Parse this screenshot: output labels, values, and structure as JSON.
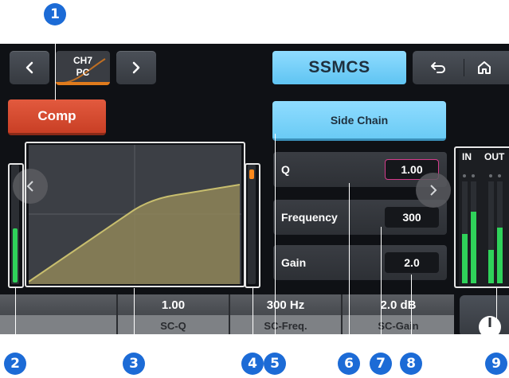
{
  "header": {
    "channel_name": "CH7",
    "channel_sub": "PC",
    "title": "SSMCS"
  },
  "comp_button": "Comp",
  "side_chain_button": "Side Chain",
  "params": [
    {
      "label": "Q",
      "value": "1.00",
      "selected": true
    },
    {
      "label": "Frequency",
      "value": "300",
      "selected": false
    },
    {
      "label": "Gain",
      "value": "2.0",
      "selected": false
    }
  ],
  "io_meter": {
    "in_label": "IN",
    "out_label": "OUT"
  },
  "bottom_strip": [
    {
      "value": "",
      "label": ""
    },
    {
      "value": "1.00",
      "label": "SC-Q"
    },
    {
      "value": "300 Hz",
      "label": "SC-Freq."
    },
    {
      "value": "2.0 dB",
      "label": "SC-Gain"
    }
  ],
  "callouts": [
    "1",
    "2",
    "3",
    "4",
    "5",
    "6",
    "7",
    "8",
    "9"
  ],
  "icons": {
    "prev": "chevron-left-icon",
    "next": "chevron-right-icon",
    "back": "return-arrow-icon",
    "home": "home-icon",
    "knob": "knob-icon"
  },
  "colors": {
    "accent_blue": "#6acbf5",
    "comp_red": "#d9482d",
    "meter_green": "#2fd25a",
    "callout_blue": "#1c6bd6",
    "selected_border": "#d43c8c"
  }
}
